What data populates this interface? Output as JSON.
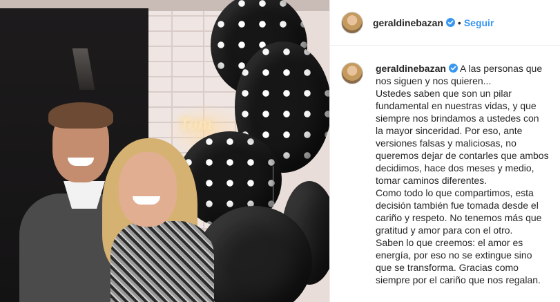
{
  "header": {
    "username": "geraldinebazan",
    "separator": "•",
    "follow_label": "Seguir",
    "verified_icon": "verified-badge-icon"
  },
  "caption": {
    "username": "geraldinebazan",
    "verified_icon": "verified-badge-icon",
    "first_line": "A las personas que nos siguen y nos quieren...",
    "paragraphs": [
      "Ustedes saben que son un pilar fundamental en nuestras vidas, y que siempre nos brindamos a ustedes con la mayor sinceridad. Por eso, ante versiones falsas y maliciosas, no queremos dejar de contarles que ambos decidimos, hace dos meses y medio, tomar caminos diferentes.",
      "Como todo lo que compartimos, esta decisión también fue tomada desde el cariño y respeto. No tenemos más que gratitud y amor para con el otro.",
      "Saben lo que creemos: el amor es energía, por eso no se extingue sino que se transforma. Gracias como siempre por el cariño que nos regalan."
    ]
  },
  "photo": {
    "sign_text": "Tom"
  },
  "colors": {
    "accent": "#3897f0",
    "text": "#262626",
    "border": "#efefef"
  }
}
